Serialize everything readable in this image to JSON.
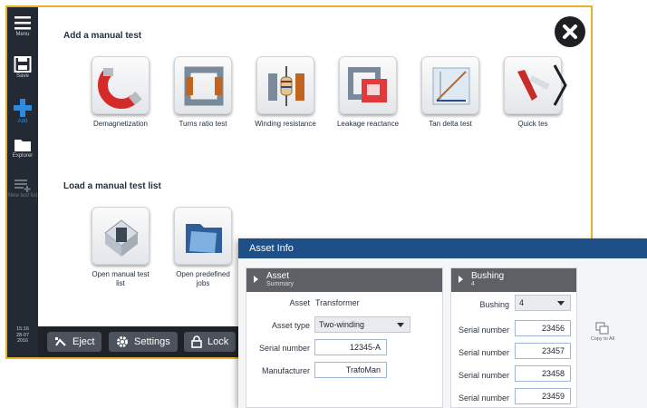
{
  "sidebar": {
    "items": [
      {
        "label": "Menu",
        "icon": "menu-icon"
      },
      {
        "label": "Save",
        "icon": "save-icon"
      },
      {
        "label": "Add",
        "icon": "add-icon"
      },
      {
        "label": "Explorer",
        "icon": "folder-icon"
      },
      {
        "label": "New test list",
        "icon": "new-list-icon"
      }
    ],
    "time": "15:16",
    "date_line1": "28-07",
    "date_line2": "2016"
  },
  "add_section": {
    "title": "Add a manual test",
    "tests": [
      {
        "label": "Demagnetization",
        "icon": "magnet-icon"
      },
      {
        "label": "Turns ratio test",
        "icon": "transformer-core-icon"
      },
      {
        "label": "Winding resistance",
        "icon": "resistor-icon"
      },
      {
        "label": "Leakage reactance",
        "icon": "leakage-icon"
      },
      {
        "label": "Tan delta test",
        "icon": "tan-delta-icon"
      },
      {
        "label": "Quick tes",
        "icon": "quick-test-icon"
      }
    ]
  },
  "load_section": {
    "title": "Load a manual test list",
    "items": [
      {
        "label_line1": "Open manual test",
        "label_line2": "list",
        "icon": "open-list-icon"
      },
      {
        "label_line1": "Open predefined",
        "label_line2": "jobs",
        "icon": "predefined-jobs-icon"
      }
    ]
  },
  "bottom_bar": {
    "eject": "Eject",
    "settings": "Settings",
    "lock": "Lock"
  },
  "asset_info": {
    "title": "Asset Info",
    "asset_panel": {
      "title": "Asset",
      "subtitle": "Summary",
      "asset_label": "Asset",
      "asset_value": "Transformer",
      "asset_type_label": "Asset type",
      "asset_type_value": "Two-winding",
      "serial_label": "Serial number",
      "serial_value": "12345-A",
      "manufacturer_label": "Manufacturer",
      "manufacturer_value": "TrafoMan"
    },
    "bushing_panel": {
      "title": "Bushing",
      "subtitle": "4",
      "bushing_label": "Bushing",
      "bushing_value": "4",
      "serials": [
        {
          "label": "Serial number",
          "value": "23456"
        },
        {
          "label": "Serial number",
          "value": "23457"
        },
        {
          "label": "Serial number",
          "value": "23458"
        },
        {
          "label": "Serial number",
          "value": "23459"
        }
      ],
      "copy_to_all": "Copy to All"
    }
  },
  "colors": {
    "accent": "#e8b32a",
    "sidebar": "#232a33",
    "titlebar": "#1f4f87",
    "add_blue": "#2a8be0"
  }
}
